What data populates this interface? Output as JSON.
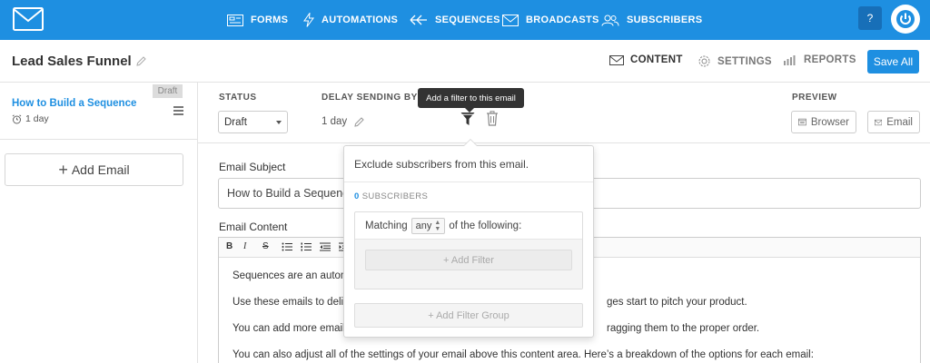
{
  "nav": {
    "items": [
      {
        "label": "FORMS",
        "icon": "forms-icon"
      },
      {
        "label": "AUTOMATIONS",
        "icon": "lightning-icon"
      },
      {
        "label": "SEQUENCES",
        "icon": "sequences-icon"
      },
      {
        "label": "BROADCASTS",
        "icon": "envelope-icon"
      },
      {
        "label": "SUBSCRIBERS",
        "icon": "users-icon"
      }
    ],
    "help_label": "?",
    "brand_color": "#1e8fe1"
  },
  "header": {
    "funnel_title": "Lead Sales Funnel",
    "tabs": [
      {
        "label": "CONTENT",
        "icon": "envelope-icon"
      },
      {
        "label": "SETTINGS",
        "icon": "gear-icon"
      },
      {
        "label": "REPORTS",
        "icon": "bar-chart-icon"
      }
    ],
    "save_label": "Save All"
  },
  "sidebar": {
    "emails": [
      {
        "badge": "Draft",
        "title": "How to Build a Sequence",
        "delay": "1 day"
      }
    ],
    "add_email_label": "Add Email"
  },
  "settings": {
    "status_label": "STATUS",
    "status_value": "Draft",
    "delay_label": "DELAY SENDING BY",
    "delay_value": "1 day",
    "tooltip": "Add a filter to this email",
    "preview_label": "PREVIEW",
    "preview_browser": "Browser",
    "preview_email": "Email"
  },
  "editor": {
    "subject_label": "Email Subject",
    "subject_value": "How to Build a Sequenc",
    "content_label": "Email Content",
    "toolbar": {
      "bold": "B",
      "italic": "I",
      "strike": "S"
    },
    "paragraphs": [
      "Sequences are an automa",
      "Use these emails to delive",
      "You can add more emails",
      "You can also adjust all of the settings of your email above this content area. Here’s a breakdown of the options for each email:"
    ],
    "paragraph_tails": [
      "",
      "ges start to pitch your product.",
      "ragging them to the proper order.",
      ""
    ]
  },
  "popover": {
    "title": "Exclude subscribers from this email.",
    "subscriber_count": "0",
    "subscriber_label": "SUBSCRIBERS",
    "matching_prefix": "Matching",
    "matching_value": "any",
    "matching_suffix": "of the following:",
    "add_filter": "+ Add Filter",
    "add_filter_group": "+ Add Filter Group"
  }
}
